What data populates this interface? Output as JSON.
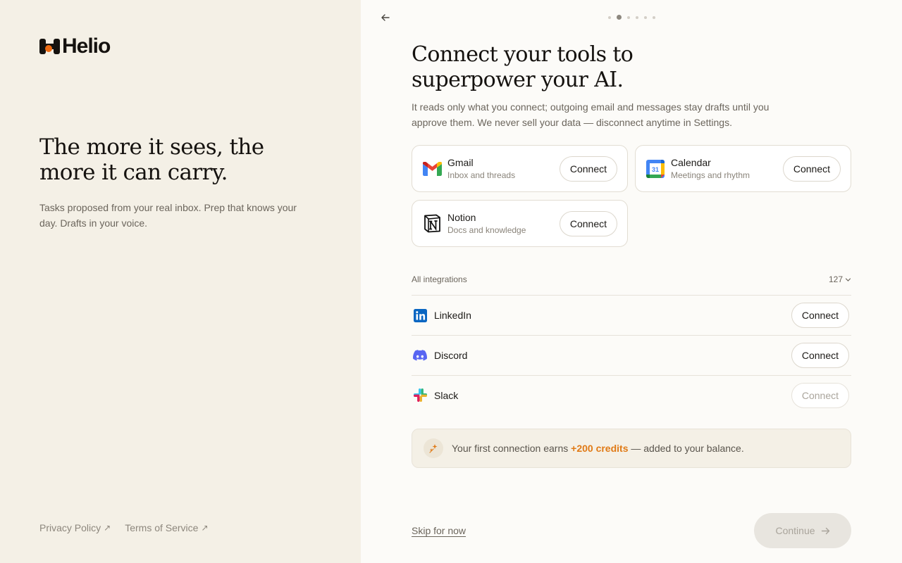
{
  "brand": {
    "name": "Helio",
    "accent": "#ec6a12"
  },
  "left": {
    "headline": "The more it sees, the more it can carry.",
    "description": "Tasks proposed from your real inbox. Prep that knows your day. Drafts in your voice.",
    "footer": {
      "privacy": "Privacy Policy",
      "terms": "Terms of Service",
      "ext_glyph": "↗"
    }
  },
  "steps": {
    "total": 6,
    "current": 2
  },
  "main": {
    "title": "Connect your tools to superpower your AI.",
    "subtitle": "It reads only what you connect; outgoing email and messages stay drafts until you approve them. We never sell your data — disconnect anytime in Settings.",
    "featured": [
      {
        "name": "Gmail",
        "desc": "Inbox and threads",
        "button": "Connect",
        "icon": "gmail-icon"
      },
      {
        "name": "Calendar",
        "desc": "Meetings and rhythm",
        "button": "Connect",
        "icon": "calendar-icon",
        "calendar_day": "31"
      },
      {
        "name": "Notion",
        "desc": "Docs and knowledge",
        "button": "Connect",
        "icon": "notion-icon"
      }
    ],
    "all_integrations": {
      "label": "All integrations",
      "count": "127",
      "items": [
        {
          "name": "LinkedIn",
          "button": "Connect",
          "icon": "linkedin-icon",
          "disabled": false
        },
        {
          "name": "Discord",
          "button": "Connect",
          "icon": "discord-icon",
          "disabled": false
        },
        {
          "name": "Slack",
          "button": "Connect",
          "icon": "slack-icon",
          "disabled": true
        }
      ]
    },
    "credits": {
      "prefix": "Your first connection earns",
      "highlight": "+200 credits",
      "suffix": "— added to your balance."
    },
    "skip_label": "Skip for now",
    "continue_label": "Continue"
  }
}
